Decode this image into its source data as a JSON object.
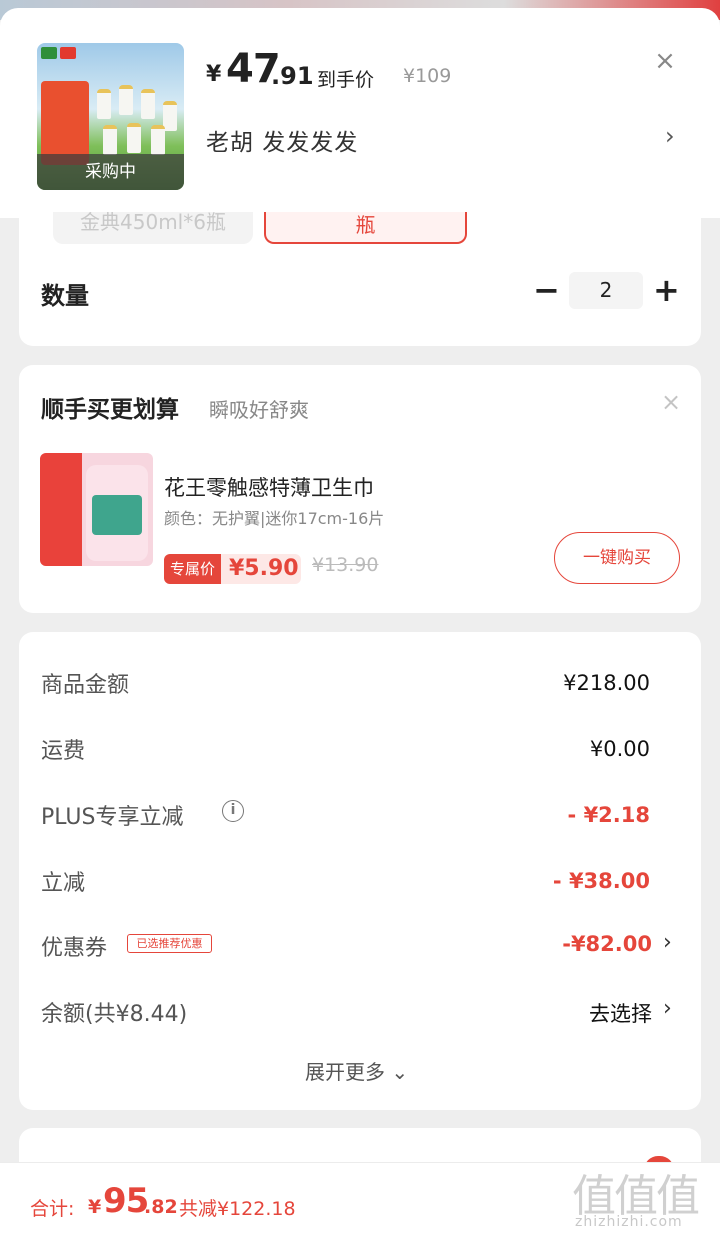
{
  "product": {
    "status": "采购中",
    "price_currency": "¥",
    "price_integer": "47",
    "price_decimal": ".91",
    "price_label": "到手价",
    "original_price": "¥109",
    "selected_spec": "老胡 发发发发"
  },
  "spec_options": [
    {
      "label": "金典450ml*6瓶",
      "selected": false
    },
    {
      "label": "瓶",
      "selected": true
    }
  ],
  "quantity": {
    "label": "数量",
    "value": "2",
    "minus": "−",
    "plus": "+"
  },
  "addon": {
    "title": "顺手买更划算",
    "subtitle": "瞬吸好舒爽",
    "product_name": "花王零触感特薄卫生巾",
    "variant": "颜色：无护翼|迷你17cm-16片",
    "price_tag": "专属价",
    "price": "¥5.90",
    "original_price": "¥13.90",
    "buy_label": "一键购买"
  },
  "summary": {
    "rows": [
      {
        "label": "商品金额",
        "value": "¥218.00",
        "tone": "black"
      },
      {
        "label": "运费",
        "value": "¥0.00",
        "tone": "black"
      },
      {
        "label": "PLUS专享立减",
        "value": "- ¥2.18",
        "tone": "red"
      },
      {
        "label": "立减",
        "value": "- ¥38.00",
        "tone": "red"
      },
      {
        "label": "优惠券",
        "value": "-¥82.00",
        "tone": "red"
      },
      {
        "label": "余额(共¥8.44)",
        "value": "去选择",
        "tone": "black"
      }
    ],
    "coupon_badge": "已选推荐优惠",
    "info_icon": "i",
    "expand_more": "展开更多 ⌄"
  },
  "footer": {
    "total_label": "合计:",
    "total_currency": "¥",
    "total_integer": "95",
    "total_decimal": ".82",
    "total_saved": "共减¥122.18"
  },
  "watermark": {
    "glyph": "值值值",
    "text": "zhizhizhi.com"
  },
  "icons": {
    "close": "close-icon",
    "chevron": "chevron-right-icon",
    "info": "info-icon"
  },
  "colors": {
    "accent": "#e5463b",
    "background": "#eeeeee"
  }
}
